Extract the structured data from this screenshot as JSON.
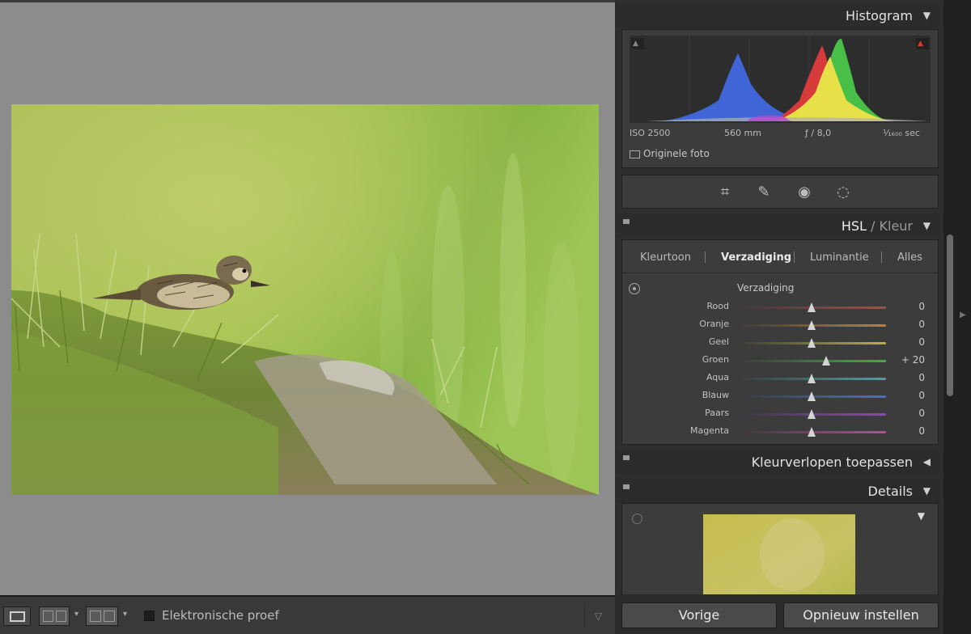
{
  "panels": {
    "histogram": {
      "title": "Histogram",
      "iso": "ISO 2500",
      "focal": "560 mm",
      "aperture": "ƒ / 8,0",
      "shutter": "¹⁄₁₆₀₀ sec",
      "original_label": "Originele foto"
    },
    "hsl": {
      "title_hsl": "HSL",
      "title_sep": "/",
      "title_color": "Kleur",
      "tabs": [
        "Kleurtoon",
        "Verzadiging",
        "Luminantie",
        "Alles"
      ],
      "active_tab": "Verzadiging",
      "section_label": "Verzadiging",
      "sliders": [
        {
          "label": "Rood",
          "value": "0",
          "level": 0,
          "color": "#b04848"
        },
        {
          "label": "Oranje",
          "value": "0",
          "level": 0,
          "color": "#b8823e"
        },
        {
          "label": "Geel",
          "value": "0",
          "level": 0,
          "color": "#b8b040"
        },
        {
          "label": "Groen",
          "value": "+ 20",
          "level": 20,
          "color": "#4aa84a"
        },
        {
          "label": "Aqua",
          "value": "0",
          "level": 0,
          "color": "#40a8a0"
        },
        {
          "label": "Blauw",
          "value": "0",
          "level": 0,
          "color": "#4a72c0"
        },
        {
          "label": "Paars",
          "value": "0",
          "level": 0,
          "color": "#8a4ab8"
        },
        {
          "label": "Magenta",
          "value": "0",
          "level": 0,
          "color": "#b84a9a"
        }
      ]
    },
    "gradients": {
      "title": "Kleurverlopen toepassen"
    },
    "details": {
      "title": "Details"
    }
  },
  "toolbar": {
    "proof_label": "Elektronische proef"
  },
  "buttons": {
    "previous": "Vorige",
    "reset": "Opnieuw instellen"
  }
}
